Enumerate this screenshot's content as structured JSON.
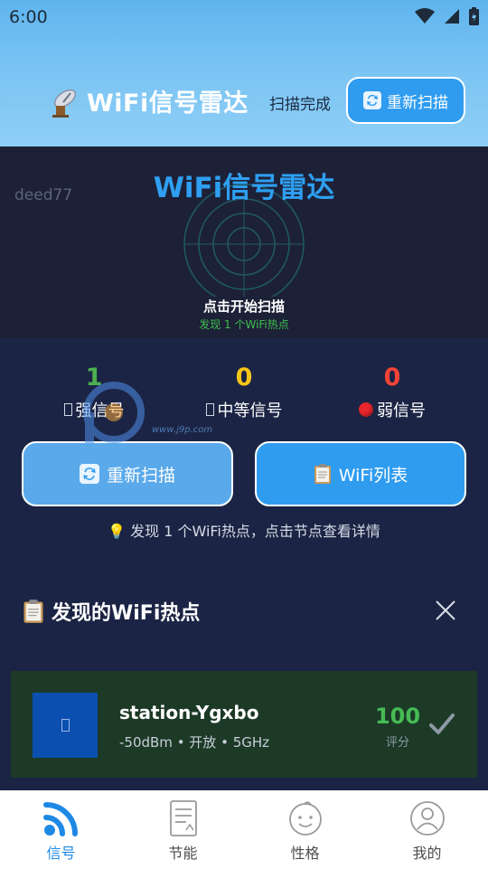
{
  "status_bar": {
    "time": "6:00"
  },
  "header": {
    "title": "WiFi信号雷达",
    "scan_status": "扫描完成",
    "rescan_label": "重新扫描"
  },
  "radar": {
    "watermark": "deed77",
    "title": "WiFi信号雷达",
    "hint": "点击开始扫描",
    "found_text": "发现 1 个WiFi热点"
  },
  "stats": [
    {
      "value": "1",
      "label": "强信号",
      "color": "#4caf50"
    },
    {
      "value": "0",
      "label": "中等信号",
      "color": "#f5c518"
    },
    {
      "value": "0",
      "label": "弱信号",
      "color": "#f44336"
    }
  ],
  "actions": {
    "rescan_label": "重新扫描",
    "wifi_list_label": "WiFi列表"
  },
  "tip": "发现 1 个WiFi热点，点击节点查看详情",
  "hotspots_section": {
    "title": "发现的WiFi热点",
    "items": [
      {
        "ssid": "station-Ygxbo",
        "details": "-50dBm • 开放 • 5GHz",
        "score": "100",
        "score_label": "评分"
      }
    ]
  },
  "watermark_logo_text": "www.j9p.com",
  "bottom_nav": [
    {
      "label": "信号",
      "icon": "wifi-signal-icon",
      "active": true
    },
    {
      "label": "节能",
      "icon": "document-icon",
      "active": false
    },
    {
      "label": "性格",
      "icon": "face-icon",
      "active": false
    },
    {
      "label": "我的",
      "icon": "profile-icon",
      "active": false
    }
  ],
  "colors": {
    "accent": "#2e9ff2",
    "strong": "#4caf50",
    "medium": "#f5c518",
    "weak": "#f44336",
    "background": "#1b2444"
  }
}
